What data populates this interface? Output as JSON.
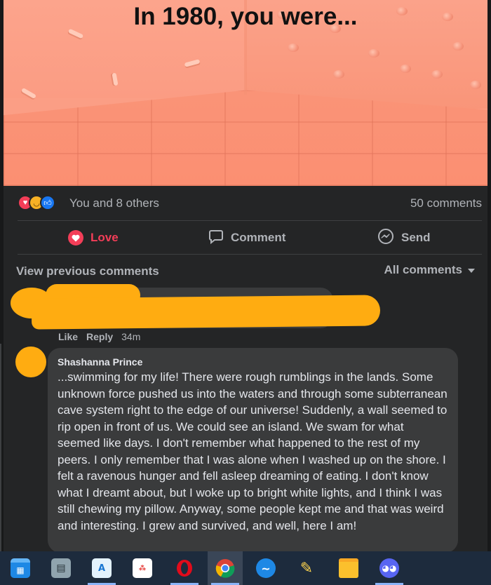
{
  "post": {
    "image_title": "In 1980, you were...",
    "reactions": {
      "icons": [
        "love-reaction",
        "haha-reaction",
        "like-reaction"
      ],
      "summary": "You and 8 others"
    },
    "comment_count": "50 comments",
    "actions": {
      "love": "Love",
      "comment": "Comment",
      "send": "Send"
    }
  },
  "comments_header": {
    "view_previous": "View previous comments",
    "filter": "All comments"
  },
  "comments": [
    {
      "author": "",
      "text": "",
      "like": "Like",
      "reply": "Reply",
      "time": "34m",
      "redacted": true
    },
    {
      "author": "Shashanna Prince",
      "text": "...swimming for my life! There were rough rumblings in the lands. Some unknown force pushed us into the waters and through some subterranean cave system right to the edge of our universe! Suddenly, a wall seemed to rip open in front of us. We could see an island. We swam for what seemed like days. I don't remember what happened to the rest of my peers. I only remember that I was alone when I washed up on the shore. I felt a ravenous hunger and fell asleep dreaming of eating. I don't know what I dreamt about, but I woke up to bright white lights, and I think I was still chewing my pillow. Anyway, some people kept me and that was weird and interesting. I grew and survived, and well, here I am!"
    }
  ],
  "taskbar": {
    "apps": [
      "calendar-icon",
      "calculator-icon",
      "paint-icon",
      "photos-icon",
      "opera-icon",
      "chrome-icon",
      "network-icon",
      "paint-3d-icon",
      "file-explorer-icon",
      "discord-icon"
    ],
    "active_app": "chrome-icon"
  },
  "colors": {
    "background": "#242526",
    "bubble": "#3a3b3c",
    "love_red": "#f33e58",
    "redaction": "#ffac11",
    "hero_peach": "#fb9e85"
  }
}
